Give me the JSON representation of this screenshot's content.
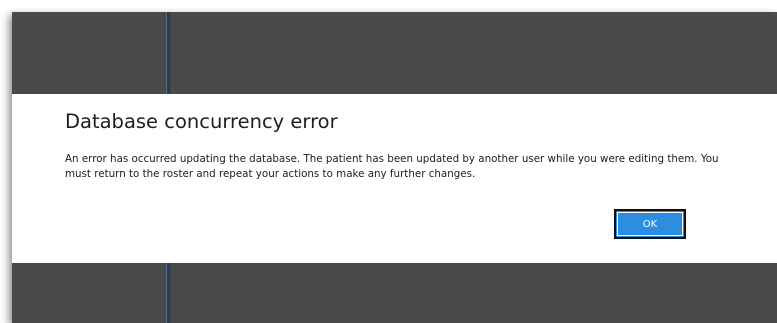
{
  "dialog": {
    "title": "Database concurrency error",
    "message": "An error has occurred updating the database.  The patient has been updated by another user while you were editing them.  You must return to the roster and repeat your actions to make any further changes.",
    "ok_label": "OK"
  },
  "colors": {
    "window_background": "#4a4a4a",
    "dialog_background": "#ffffff",
    "accent_button": "#2b8ee0",
    "text": "#1e1e1e"
  }
}
